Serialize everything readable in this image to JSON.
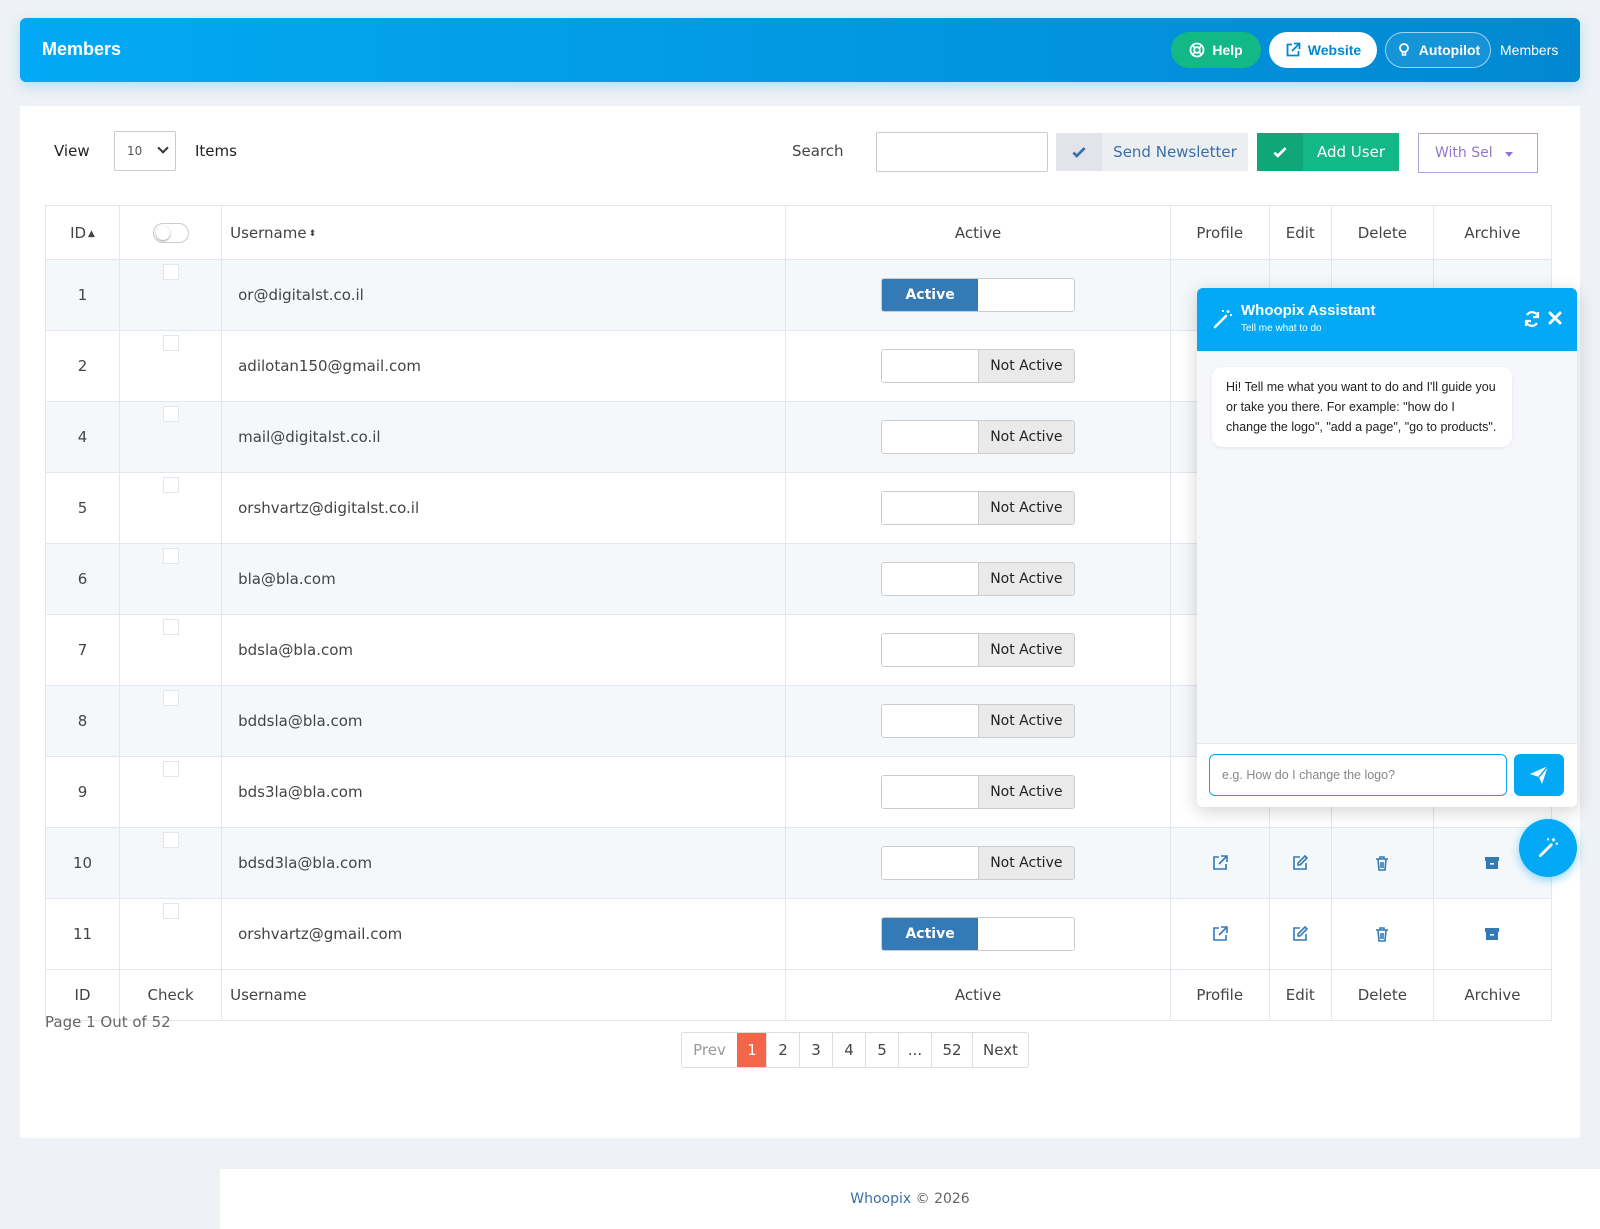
{
  "header": {
    "title": "Members",
    "help_label": "Help",
    "website_label": "Website",
    "autopilot_label": "Autopilot",
    "breadcrumb": "Members"
  },
  "toolbar": {
    "view_label": "View",
    "view_value": "10",
    "items_label": "Items",
    "search_label": "Search",
    "search_value": "",
    "send_newsletter_label": "Send Newsletter",
    "add_user_label": "Add User",
    "with_selected_label": "With Sel"
  },
  "table": {
    "headers": {
      "id": "ID",
      "username": "Username",
      "active": "Active",
      "profile": "Profile",
      "edit": "Edit",
      "delete": "Delete",
      "archive": "Archive"
    },
    "footers": {
      "id": "ID",
      "check": "Check",
      "username": "Username",
      "active": "Active",
      "profile": "Profile",
      "edit": "Edit",
      "delete": "Delete",
      "archive": "Archive"
    },
    "rows": [
      {
        "id": "1",
        "username": "or@digitalst.co.il",
        "status": "Active",
        "active": true
      },
      {
        "id": "2",
        "username": "adilotan150@gmail.com",
        "status": "Not Active",
        "active": false
      },
      {
        "id": "4",
        "username": "mail@digitalst.co.il",
        "status": "Not Active",
        "active": false
      },
      {
        "id": "5",
        "username": "orshvartz@digitalst.co.il",
        "status": "Not Active",
        "active": false
      },
      {
        "id": "6",
        "username": "bla@bla.com",
        "status": "Not Active",
        "active": false
      },
      {
        "id": "7",
        "username": "bdsla@bla.com",
        "status": "Not Active",
        "active": false
      },
      {
        "id": "8",
        "username": "bddsla@bla.com",
        "status": "Not Active",
        "active": false
      },
      {
        "id": "9",
        "username": "bds3la@bla.com",
        "status": "Not Active",
        "active": false
      },
      {
        "id": "10",
        "username": "bdsd3la@bla.com",
        "status": "Not Active",
        "active": false
      },
      {
        "id": "11",
        "username": "orshvartz@gmail.com",
        "status": "Active",
        "active": true
      }
    ]
  },
  "pagination": {
    "info": "Page 1 Out of 52",
    "prev": "Prev",
    "next": "Next",
    "pages": [
      "1",
      "2",
      "3",
      "4",
      "5",
      "...",
      "52"
    ],
    "current": "1"
  },
  "footer": {
    "brand": "Whoopix",
    "copyright": " © 2026"
  },
  "assistant": {
    "title": "Whoopix Assistant",
    "subtitle": "Tell me what to do",
    "message": "Hi! Tell me what you want to do and I'll guide you or take you there. For example: \"how do I change the logo\", \"add a page\", \"go to products\".",
    "input_placeholder": "e.g. How do I change the logo?"
  },
  "colors": {
    "primary": "#03a9f4",
    "success": "#12b886",
    "active_toggle": "#337ab7",
    "pager_current": "#f4664a",
    "with_selected": "#9575cd"
  },
  "icons": {
    "help": "lifebuoy-icon",
    "website": "external-link-icon",
    "autopilot": "bulb-icon",
    "profile": "external-link-icon",
    "edit": "edit-icon",
    "delete": "trash-icon",
    "archive": "archive-icon",
    "assistant": "magic-wand-icon",
    "send": "paper-plane-icon"
  }
}
